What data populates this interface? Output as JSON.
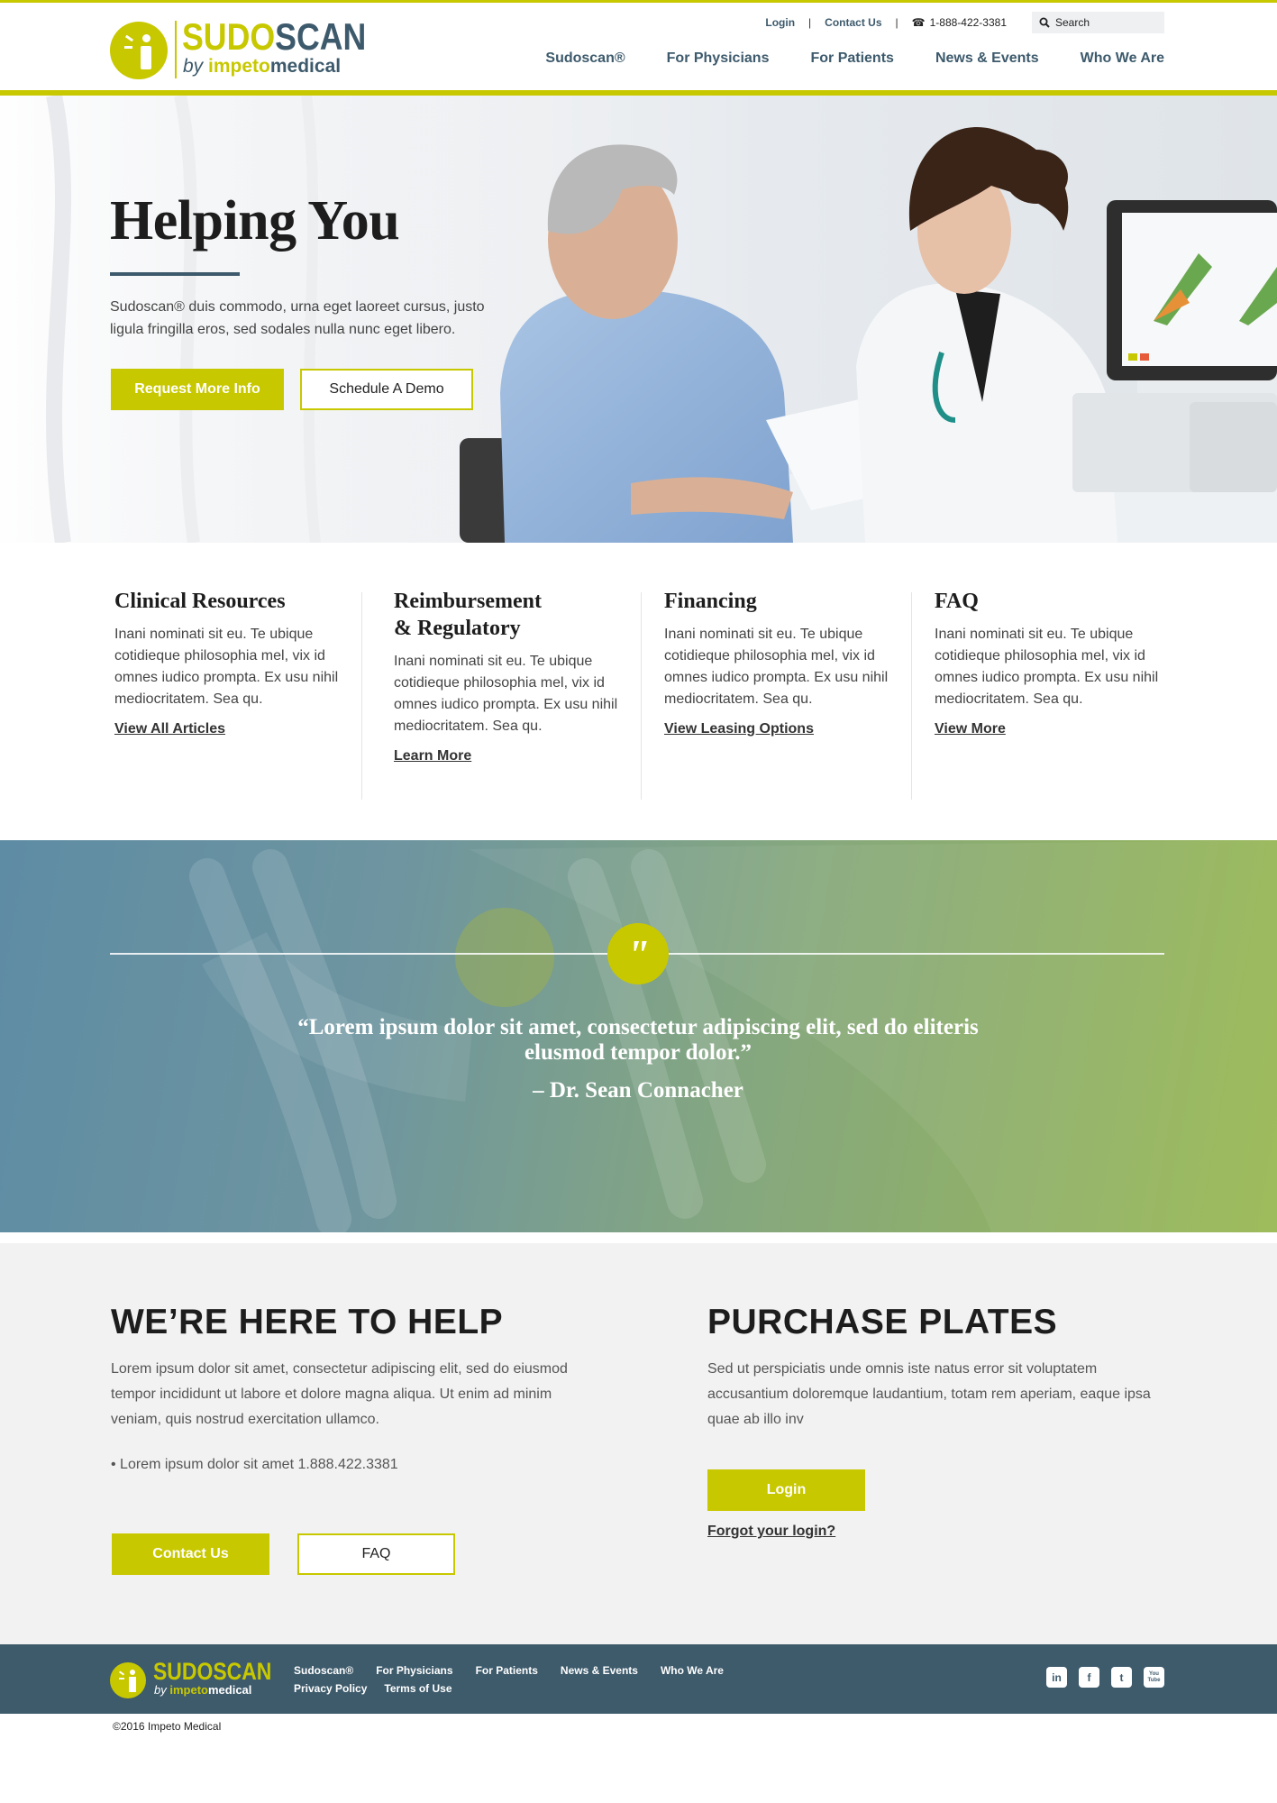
{
  "brand": {
    "name_part1": "SUDO",
    "name_part2": "SCAN",
    "by": "by",
    "company_part1": "impeto",
    "company_part2": "medical",
    "colors": {
      "accent": "#c8c800",
      "navy": "#3d5a6c"
    }
  },
  "utility": {
    "login": "Login",
    "sep1": "|",
    "contact": "Contact Us",
    "sep2": "|",
    "phone": "1-888-422-3381",
    "search": "Search"
  },
  "nav": {
    "items": [
      "Sudoscan®",
      "For Physicians",
      "For Patients",
      "News & Events",
      "Who We Are"
    ]
  },
  "hero": {
    "title": "Helping You",
    "text": "Sudoscan® duis commodo, urna eget laoreet cursus, justo ligula fringilla eros, sed sodales nulla nunc eget libero.",
    "primary_button": "Request More Info",
    "secondary_button": "Schedule A Demo"
  },
  "cards": [
    {
      "title": "Clinical Resources",
      "text": "Inani nominati sit eu. Te ubique cotidieque philosophia mel, vix id omnes iudico prompta. Ex usu nihil mediocritatem. Sea qu.",
      "link": "View All Articles"
    },
    {
      "title_line1": "Reimbursement",
      "title_line2": "& Regulatory",
      "text": "Inani nominati sit eu. Te ubique cotidieque philosophia mel, vix id omnes iudico prompta. Ex usu nihil mediocritatem. Sea qu.",
      "link": "Learn More"
    },
    {
      "title": "Financing",
      "text": "Inani nominati sit eu. Te ubique cotidieque philosophia mel, vix id omnes iudico prompta. Ex usu nihil mediocritatem. Sea qu.",
      "link": "View Leasing Options"
    },
    {
      "title": "FAQ",
      "text": "Inani nominati sit eu. Te ubique cotidieque philosophia mel, vix id omnes iudico prompta. Ex usu nihil mediocritatem. Sea qu.",
      "link": "View More"
    }
  ],
  "quote": {
    "icon": "quote-icon",
    "mark": "\"",
    "text": "“Lorem ipsum dolor sit amet, consectetur adipiscing elit, sed do eliteris elusmod tempor dolor.”",
    "author": "– Dr. Sean Connacher"
  },
  "help": {
    "title": "WE’RE HERE TO HELP",
    "text": "Lorem ipsum dolor sit amet, consectetur adipiscing elit, sed do eiusmod tempor incididunt ut labore et dolore magna aliqua. Ut enim ad minim veniam, quis nostrud exercitation ullamco.",
    "bullet": "• Lorem ipsum dolor sit amet 1.888.422.3381",
    "contact_button": "Contact Us",
    "faq_button": "FAQ"
  },
  "purchase": {
    "title": "PURCHASE PLATES",
    "text": "Sed ut perspiciatis unde omnis iste natus error sit voluptatem accusantium doloremque laudantium, totam rem aperiam, eaque ipsa quae ab illo inv",
    "login_button": "Login",
    "forgot": "Forgot your login?"
  },
  "footer": {
    "row1": [
      "Sudoscan®",
      "For Physicians",
      "For Patients",
      "News & Events",
      "Who We Are"
    ],
    "row2": [
      "Privacy Policy",
      "Terms of Use"
    ],
    "social": [
      "in",
      "f",
      "t",
      "You Tube"
    ],
    "copyright": "©2016 Impeto Medical"
  }
}
